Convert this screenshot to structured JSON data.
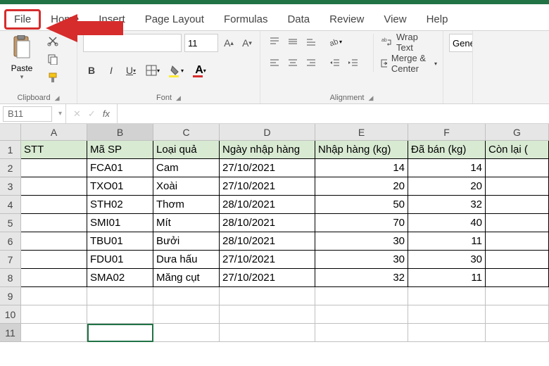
{
  "menu": {
    "file": "File",
    "home": "Home",
    "insert": "Insert",
    "pagelayout": "Page Layout",
    "formulas": "Formulas",
    "data": "Data",
    "review": "Review",
    "view": "View",
    "help": "Help"
  },
  "ribbon": {
    "clipboard": {
      "label": "Clipboard",
      "paste": "Paste"
    },
    "font": {
      "label": "Font",
      "name": "",
      "size": "11",
      "bold": "B",
      "italic": "I",
      "underline": "U"
    },
    "alignment": {
      "label": "Alignment",
      "wrap": "Wrap Text",
      "merge": "Merge & Center"
    },
    "number": {
      "general": "Gene"
    }
  },
  "namebox": "B11",
  "fx": "fx",
  "columns": [
    "A",
    "B",
    "C",
    "D",
    "E",
    "F",
    "G"
  ],
  "row_numbers": [
    "1",
    "2",
    "3",
    "4",
    "5",
    "6",
    "7",
    "8",
    "9",
    "10",
    "11"
  ],
  "headers": [
    "STT",
    "Mã SP",
    "Loại quả",
    "Ngày nhập hàng",
    "Nhập hàng (kg)",
    "Đã bán  (kg)",
    "Còn lại ("
  ],
  "rows": [
    {
      "stt": "",
      "ma": "FCA01",
      "loai": "Cam",
      "ngay": "27/10/2021",
      "nhap": "14",
      "ban": "14"
    },
    {
      "stt": "",
      "ma": "TXO01",
      "loai": "Xoài",
      "ngay": "27/10/2021",
      "nhap": "20",
      "ban": "20"
    },
    {
      "stt": "",
      "ma": "STH02",
      "loai": "Thơm",
      "ngay": "28/10/2021",
      "nhap": "50",
      "ban": "32"
    },
    {
      "stt": "",
      "ma": "SMI01",
      "loai": "Mít",
      "ngay": "28/10/2021",
      "nhap": "70",
      "ban": "40"
    },
    {
      "stt": "",
      "ma": "TBU01",
      "loai": "Bưởi",
      "ngay": "28/10/2021",
      "nhap": "30",
      "ban": "11"
    },
    {
      "stt": "",
      "ma": "FDU01",
      "loai": "Dưa hấu",
      "ngay": "27/10/2021",
      "nhap": "30",
      "ban": "30"
    },
    {
      "stt": "",
      "ma": "SMA02",
      "loai": "Măng cụt",
      "ngay": "27/10/2021",
      "nhap": "32",
      "ban": "11"
    }
  ],
  "selected_cell": "B11"
}
